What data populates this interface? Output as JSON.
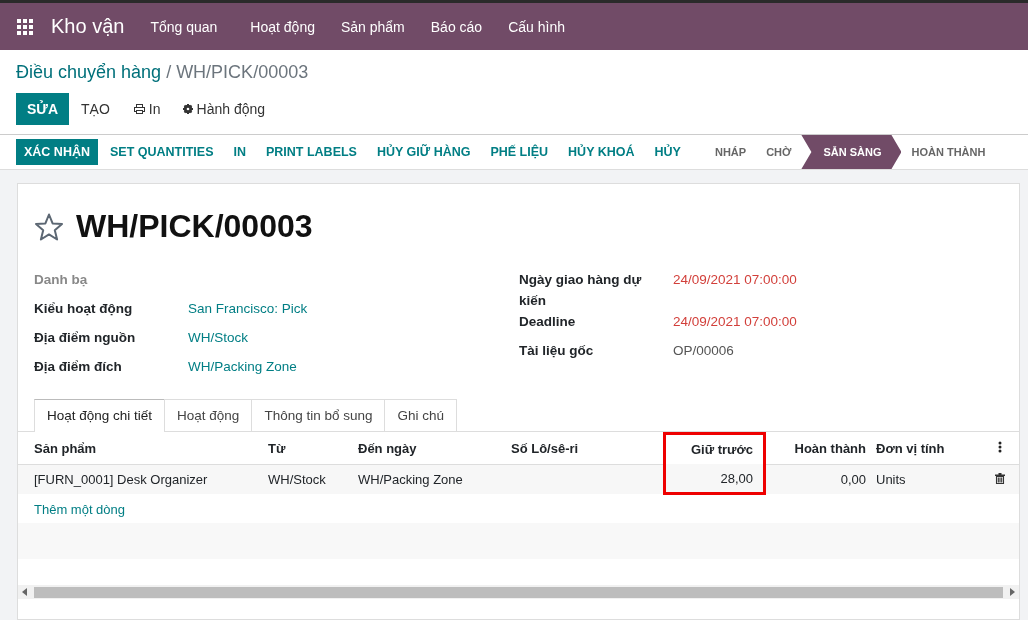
{
  "nav": {
    "app_name": "Kho vận",
    "menu": [
      "Tổng quan",
      "Hoạt động",
      "Sản phẩm",
      "Báo cáo",
      "Cấu hình"
    ]
  },
  "breadcrumb": {
    "parent": "Điều chuyển hàng",
    "current": "/ WH/PICK/00003"
  },
  "control_buttons": [
    {
      "kind": "primary",
      "label": "SỬA"
    },
    {
      "kind": "plain",
      "label": "TẠO"
    },
    {
      "kind": "print",
      "label": "In"
    },
    {
      "kind": "action",
      "label": "Hành động"
    }
  ],
  "header_buttons": [
    {
      "kind": "primary",
      "label": "XÁC NHẬN"
    },
    {
      "kind": "plain",
      "label": "SET QUANTITIES"
    },
    {
      "kind": "plain",
      "label": "IN"
    },
    {
      "kind": "plain",
      "label": "PRINT LABELS"
    },
    {
      "kind": "plain",
      "label": "HỦY GIỮ HÀNG"
    },
    {
      "kind": "plain",
      "label": "PHẾ LIỆU"
    },
    {
      "kind": "plain",
      "label": "HỦY KHOÁ"
    },
    {
      "kind": "plain",
      "label": "HỦY"
    }
  ],
  "stages": [
    {
      "label": "NHÁP",
      "selected": false
    },
    {
      "label": "CHỜ",
      "selected": false
    },
    {
      "label": "SẴN SÀNG",
      "selected": true
    },
    {
      "label": "HOÀN THÀNH",
      "selected": false
    }
  ],
  "record": {
    "title": "WH/PICK/00003",
    "starred": false
  },
  "left_fields": [
    {
      "label": "Danh bạ"
    },
    {
      "label": "Kiểu hoạt động",
      "value": "San Francisco: Pick"
    },
    {
      "label": "Địa điểm nguồn",
      "value": "WH/Stock"
    },
    {
      "label": "Địa điểm đích",
      "value": "WH/Packing Zone"
    }
  ],
  "right_fields": [
    {
      "label": "Ngày giao hàng dự kiến",
      "value": "24/09/2021 07:00:00",
      "overdue": true
    },
    {
      "label": "Deadline",
      "value": "24/09/2021 07:00:00",
      "overdue": true
    },
    {
      "label": "Tài liệu gốc",
      "value": "OP/00006",
      "overdue": false
    }
  ],
  "tabs": [
    {
      "label": "Hoạt động chi tiết",
      "selected": true
    },
    {
      "label": "Hoạt động",
      "selected": false
    },
    {
      "label": "Thông tin bổ sung",
      "selected": false
    },
    {
      "label": "Ghi chú",
      "selected": false
    }
  ],
  "table": {
    "columns": [
      {
        "label": "Sản phẩm",
        "kind": "text",
        "highlighted": false
      },
      {
        "label": "Từ",
        "kind": "text",
        "highlighted": false
      },
      {
        "label": "Đến ngày",
        "kind": "text",
        "highlighted": false
      },
      {
        "label": "Số Lô/sê-ri",
        "kind": "text",
        "highlighted": false
      },
      {
        "label": "Giữ trước",
        "kind": "number",
        "highlighted": true
      },
      {
        "label": "Hoàn thành",
        "kind": "number",
        "highlighted": false
      },
      {
        "label": "Đơn vị tính",
        "kind": "text",
        "highlighted": false
      }
    ],
    "rows": [
      [
        "[FURN_0001] Desk Organizer",
        "WH/Stock",
        "WH/Packing Zone",
        "",
        "28,00",
        "0,00",
        "Units"
      ]
    ],
    "add_line": "Thêm một dòng"
  }
}
